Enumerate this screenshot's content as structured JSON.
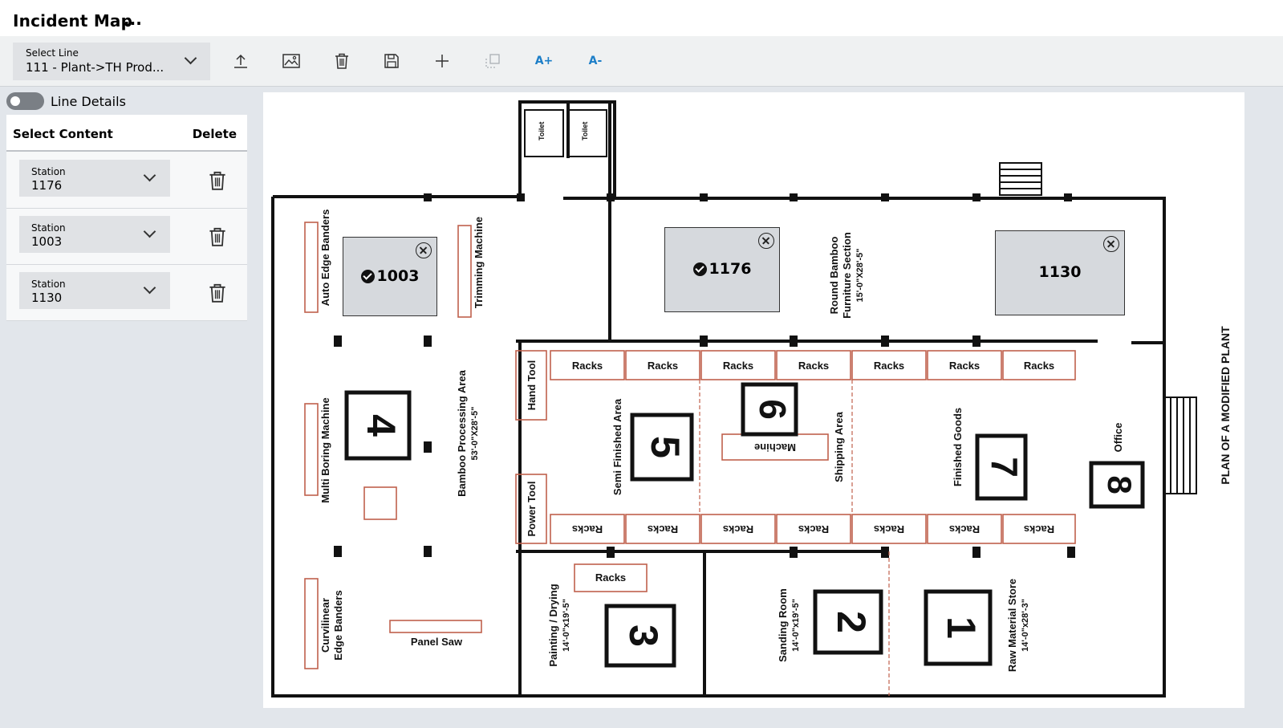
{
  "header": {
    "title": "Incident Map",
    "more": "..."
  },
  "toolbar": {
    "select_line_label": "Select Line",
    "select_line_value": "111 - Plant->TH Prod...",
    "font_increase": "A+",
    "font_decrease": "A-"
  },
  "sidebar": {
    "toggle_label": "Line Details",
    "toggle_on": false,
    "col_select": "Select Content",
    "col_delete": "Delete",
    "rows": [
      {
        "label": "Station",
        "value": "1176"
      },
      {
        "label": "Station",
        "value": "1003"
      },
      {
        "label": "Station",
        "value": "1130"
      }
    ]
  },
  "map": {
    "stations": [
      {
        "id": "1003",
        "checked": true
      },
      {
        "id": "1176",
        "checked": true
      },
      {
        "id": "1130",
        "checked": false
      }
    ],
    "plan_title": "PLAN OF A MODIFIED PLANT",
    "zones": [
      "1",
      "2",
      "3",
      "4",
      "5",
      "6",
      "7",
      "8"
    ],
    "labels": {
      "auto_edge": "Auto Edge Banders",
      "trimming": "Trimming Machine",
      "multi_boring": "Multi Boring Machine",
      "bamboo_area": "Bamboo Processing Area",
      "bamboo_dim": "53'-0\"X28'-5\"",
      "curvilinear": "Curvilinear",
      "edge_banders": "Edge Banders",
      "panel_saw": "Panel Saw",
      "hand_tool": "Hand Tool",
      "power_tool": "Power Tool",
      "racks": "Racks",
      "semi_finished": "Semi Finished Area",
      "machine": "Machine",
      "shipping": "Shipping Area",
      "finished_goods": "Finished Goods",
      "office": "Office",
      "painting": "Painting / Drying",
      "painting_dim": "14'-0\"x19'-5\"",
      "sanding": "Sanding Room",
      "sanding_dim": "14'-0\"x19'-5\"",
      "raw_material": "Raw Material Store",
      "raw_dim": "14'-0\"x28'-3\"",
      "round_bamboo": "Round Bamboo",
      "furniture_section": "Furniture Section",
      "furniture_dim": "15'-0\"X28'-5\"",
      "toilet": "Toilet"
    }
  }
}
